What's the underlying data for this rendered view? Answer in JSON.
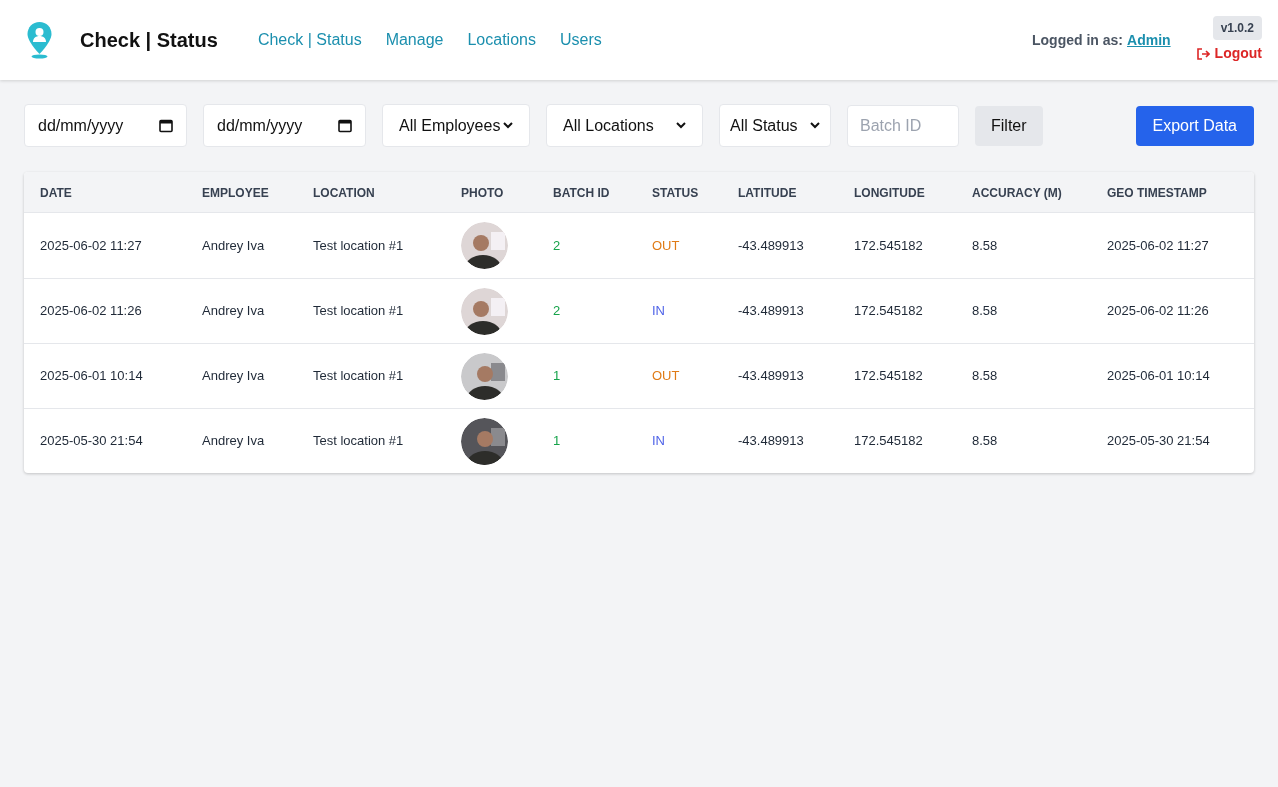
{
  "header": {
    "brand": "Check | Status",
    "nav": [
      {
        "label": "Check | Status"
      },
      {
        "label": "Manage"
      },
      {
        "label": "Locations"
      },
      {
        "label": "Users"
      }
    ],
    "logged_in_label": "Logged in as:",
    "user": "Admin",
    "version": "v1.0.2",
    "logout": "Logout"
  },
  "filters": {
    "date_from": {
      "placeholder": "dd/mm/yyyy"
    },
    "date_to": {
      "placeholder": "dd/mm/yyyy"
    },
    "employee": "All Employees",
    "location": "All Locations",
    "status": "All Status",
    "batch": {
      "placeholder": "Batch ID"
    },
    "filter_button": "Filter",
    "export_button": "Export Data"
  },
  "table": {
    "columns": [
      "DATE",
      "EMPLOYEE",
      "LOCATION",
      "PHOTO",
      "BATCH ID",
      "STATUS",
      "LATITUDE",
      "LONGITUDE",
      "ACCURACY (M)",
      "GEO TIMESTAMP"
    ],
    "rows": [
      {
        "date": "2025-06-02 11:27",
        "employee": "Andrey Iva",
        "location": "Test location #1",
        "batch": "2",
        "status": {
          "label": "OUT",
          "kind": "out"
        },
        "latitude": "-43.489913",
        "longitude": "172.545182",
        "accuracy": "8.58",
        "geo_timestamp": "2025-06-02 11:27"
      },
      {
        "date": "2025-06-02 11:26",
        "employee": "Andrey Iva",
        "location": "Test location #1",
        "batch": "2",
        "status": {
          "label": "IN",
          "kind": "in"
        },
        "latitude": "-43.489913",
        "longitude": "172.545182",
        "accuracy": "8.58",
        "geo_timestamp": "2025-06-02 11:26"
      },
      {
        "date": "2025-06-01 10:14",
        "employee": "Andrey Iva",
        "location": "Test location #1",
        "batch": "1",
        "status": {
          "label": "OUT",
          "kind": "out"
        },
        "latitude": "-43.489913",
        "longitude": "172.545182",
        "accuracy": "8.58",
        "geo_timestamp": "2025-06-01 10:14"
      },
      {
        "date": "2025-05-30 21:54",
        "employee": "Andrey Iva",
        "location": "Test location #1",
        "batch": "1",
        "status": {
          "label": "IN",
          "kind": "in"
        },
        "latitude": "-43.489913",
        "longitude": "172.545182",
        "accuracy": "8.58",
        "geo_timestamp": "2025-05-30 21:54"
      }
    ]
  }
}
